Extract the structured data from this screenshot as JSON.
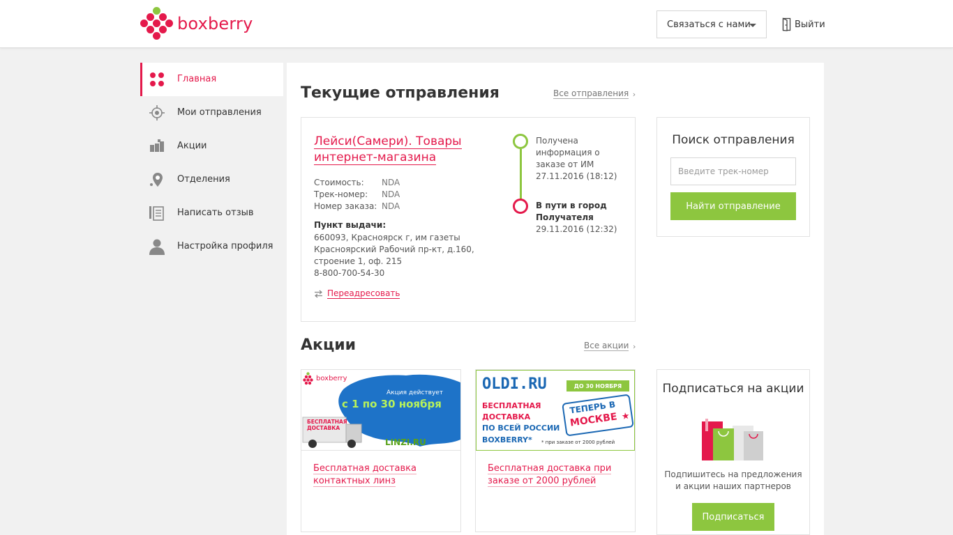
{
  "header": {
    "logo_text": "boxberry",
    "contact_label": "Связаться с нами",
    "logout_label": "Выйти"
  },
  "sidebar": {
    "items": [
      {
        "label": "Главная",
        "icon": "dots-grid-icon",
        "active": true
      },
      {
        "label": "Мои отправления",
        "icon": "target-icon",
        "active": false
      },
      {
        "label": "Акции",
        "icon": "gift-box-icon",
        "active": false
      },
      {
        "label": "Отделения",
        "icon": "map-pin-icon",
        "active": false
      },
      {
        "label": "Написать отзыв",
        "icon": "review-icon",
        "active": false
      },
      {
        "label": "Настройка профиля",
        "icon": "user-icon",
        "active": false
      }
    ]
  },
  "shipments": {
    "title": "Текущие отправления",
    "all_link": "Все отправления",
    "card": {
      "title": "Лейси(Самери). Товары интернет-магазина",
      "fields": [
        {
          "key": "Стоимость:",
          "value": "NDA"
        },
        {
          "key": "Трек-номер:",
          "value": "NDA"
        },
        {
          "key": "Номер заказа:",
          "value": "NDA"
        }
      ],
      "pickup_label": "Пункт выдачи:",
      "pickup_address": "660093, Красноярск г, им газеты Красноярский Рабочий пр-кт, д.160, строение 1, оф. 215",
      "pickup_phone": "8-800-700-54-30",
      "readdress_label": "Переадресовать",
      "timeline": [
        {
          "text": "Получена информация о заказе от ИМ",
          "date": "27.11.2016 (18:12)",
          "status": "done"
        },
        {
          "text": "В пути в город Получателя",
          "date": "29.11.2016 (12:32)",
          "status": "current"
        }
      ]
    }
  },
  "search": {
    "title": "Поиск отправления",
    "placeholder": "Введите трек-номер",
    "button": "Найти отправление"
  },
  "promos": {
    "title": "Акции",
    "all_link": "Все акции",
    "items": [
      {
        "link": "Бесплатная доставка контактных линз",
        "banner": {
          "brand": "boxberry",
          "line1": "Акция действует",
          "line2": "с 1 по 30 ноября",
          "truck_text1": "БЕСПЛАТНАЯ",
          "truck_text2": "ДОСТАВКА",
          "partner": "LINZI.RU"
        }
      },
      {
        "link": "Бесплатная доставка при заказе от 2000 рублей",
        "banner": {
          "brand": "OLDI.RU",
          "badge": "ДО 30 НОЯБРЯ",
          "text1": "БЕСПЛАТНАЯ",
          "text2": "ДОСТАВКА",
          "text3": "ПО ВСЕЙ РОССИИ",
          "text4": "BOXBERRY*",
          "stamp1": "ТЕПЕРЬ В",
          "stamp2": "МОСКВЕ",
          "footnote": "* при заказе от 2000 рублей"
        }
      }
    ]
  },
  "subscribe": {
    "title": "Подписаться на акции",
    "text": "Подпишитесь на предложения и акции наших партнеров",
    "button": "Подписаться"
  },
  "colors": {
    "brand_red": "#e4194b",
    "brand_green": "#8dc63f"
  }
}
